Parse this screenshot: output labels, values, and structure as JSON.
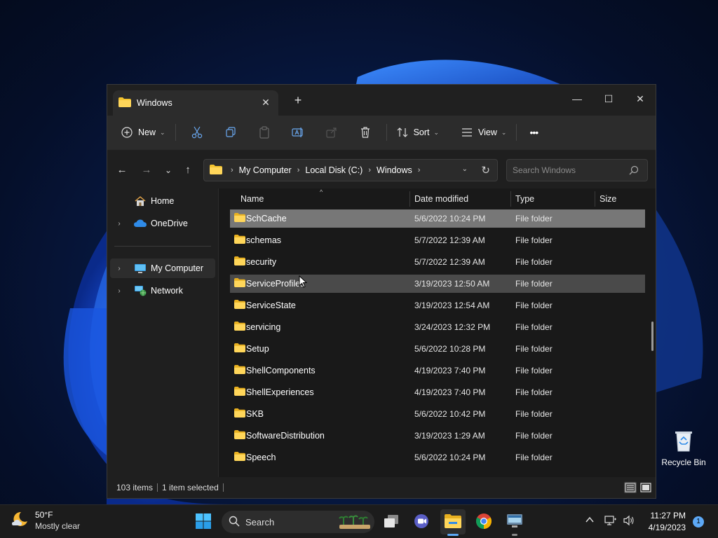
{
  "window": {
    "tab_title": "Windows",
    "tab_close": "✕",
    "new_tab": "+",
    "minimize": "—",
    "maximize": "☐",
    "close": "✕"
  },
  "toolbar": {
    "new_label": "New",
    "sort_label": "Sort",
    "view_label": "View",
    "more_label": "•••"
  },
  "navigation": {
    "breadcrumbs": [
      "My Computer",
      "Local Disk (C:)",
      "Windows"
    ],
    "search_placeholder": "Search Windows"
  },
  "sidebar": {
    "items": [
      {
        "label": "Home",
        "icon": "home-icon"
      },
      {
        "label": "OneDrive",
        "icon": "cloud-icon"
      },
      {
        "label": "My Computer",
        "icon": "computer-icon"
      },
      {
        "label": "Network",
        "icon": "network-icon"
      }
    ]
  },
  "columns": {
    "name": "Name",
    "date": "Date modified",
    "type": "Type",
    "size": "Size"
  },
  "files": [
    {
      "name": "SchCache",
      "date": "5/6/2022 10:24 PM",
      "type": "File folder"
    },
    {
      "name": "schemas",
      "date": "5/7/2022 12:39 AM",
      "type": "File folder"
    },
    {
      "name": "security",
      "date": "5/7/2022 12:39 AM",
      "type": "File folder"
    },
    {
      "name": "ServiceProfiles",
      "date": "3/19/2023 12:50 AM",
      "type": "File folder"
    },
    {
      "name": "ServiceState",
      "date": "3/19/2023 12:54 AM",
      "type": "File folder"
    },
    {
      "name": "servicing",
      "date": "3/24/2023 12:32 PM",
      "type": "File folder"
    },
    {
      "name": "Setup",
      "date": "5/6/2022 10:28 PM",
      "type": "File folder"
    },
    {
      "name": "ShellComponents",
      "date": "4/19/2023 7:40 PM",
      "type": "File folder"
    },
    {
      "name": "ShellExperiences",
      "date": "4/19/2023 7:40 PM",
      "type": "File folder"
    },
    {
      "name": "SKB",
      "date": "5/6/2022 10:42 PM",
      "type": "File folder"
    },
    {
      "name": "SoftwareDistribution",
      "date": "3/19/2023 1:29 AM",
      "type": "File folder"
    },
    {
      "name": "Speech",
      "date": "5/6/2022 10:24 PM",
      "type": "File folder"
    }
  ],
  "status": {
    "item_count": "103 items",
    "selection": "1 item selected"
  },
  "desktop": {
    "recycle_bin": "Recycle Bin"
  },
  "taskbar": {
    "temperature": "50°F",
    "condition": "Mostly clear",
    "search_label": "Search",
    "time": "11:27 PM",
    "date": "4/19/2023",
    "notification_count": "1"
  },
  "colors": {
    "accent": "#5da9f6",
    "folder": "#f4c430",
    "selected_row": "#777777",
    "hover_row": "#4a4a4a"
  }
}
